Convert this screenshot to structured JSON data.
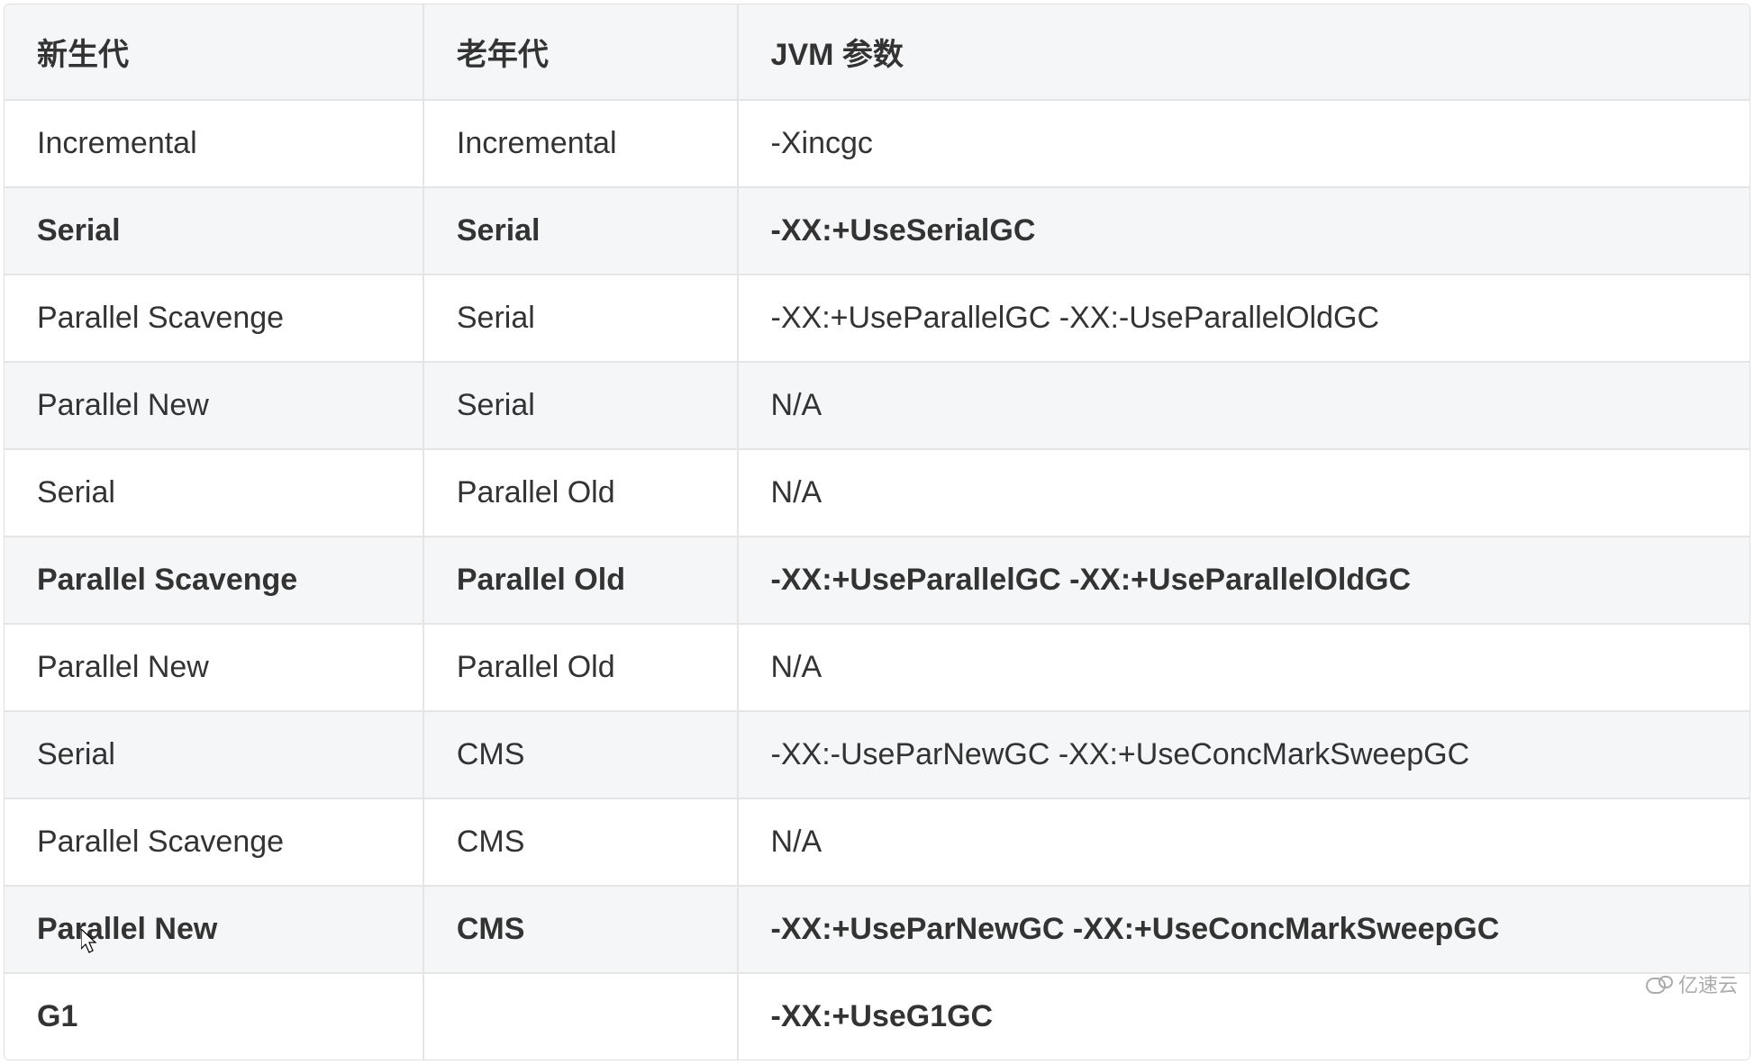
{
  "table": {
    "headers": [
      "新生代",
      "老年代",
      "JVM 参数"
    ],
    "rows": [
      {
        "cells": [
          "Incremental",
          "Incremental",
          "-Xincgc"
        ],
        "bold": false
      },
      {
        "cells": [
          "Serial",
          "Serial",
          "-XX:+UseSerialGC"
        ],
        "bold": true
      },
      {
        "cells": [
          "Parallel Scavenge",
          "Serial",
          "-XX:+UseParallelGC -XX:-UseParallelOldGC"
        ],
        "bold": false
      },
      {
        "cells": [
          "Parallel New",
          "Serial",
          "N/A"
        ],
        "bold": false
      },
      {
        "cells": [
          "Serial",
          "Parallel Old",
          "N/A"
        ],
        "bold": false
      },
      {
        "cells": [
          "Parallel Scavenge",
          "Parallel Old",
          "-XX:+UseParallelGC -XX:+UseParallelOldGC"
        ],
        "bold": true
      },
      {
        "cells": [
          "Parallel New",
          "Parallel Old",
          "N/A"
        ],
        "bold": false
      },
      {
        "cells": [
          "Serial",
          "CMS",
          "-XX:-UseParNewGC -XX:+UseConcMarkSweepGC"
        ],
        "bold": false
      },
      {
        "cells": [
          "Parallel Scavenge",
          "CMS",
          "N/A"
        ],
        "bold": false
      },
      {
        "cells": [
          "Parallel New",
          "CMS",
          "-XX:+UseParNewGC -XX:+UseConcMarkSweepGC"
        ],
        "bold": true
      },
      {
        "cells": [
          "G1",
          "",
          "-XX:+UseG1GC"
        ],
        "bold": true
      }
    ]
  },
  "watermark": {
    "text": "亿速云"
  }
}
